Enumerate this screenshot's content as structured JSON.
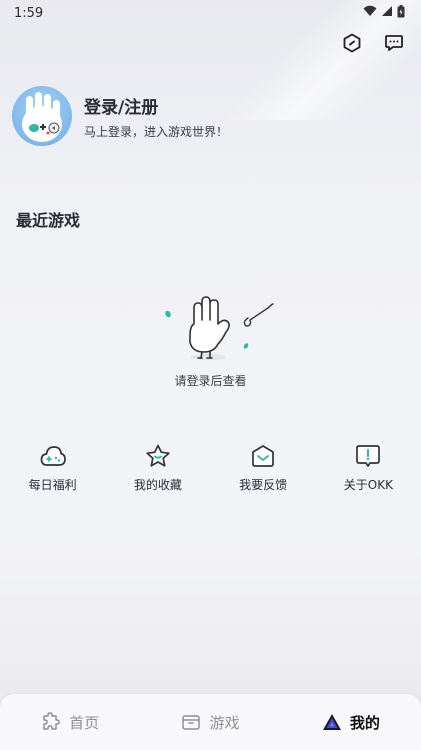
{
  "status_bar": {
    "time": "1:59",
    "icons": [
      "wifi-icon",
      "signal-icon",
      "battery-icon"
    ]
  },
  "top_actions": {
    "icons": [
      "settings-hex-icon",
      "message-icon"
    ]
  },
  "profile": {
    "title": "登录/注册",
    "subtitle": "马上登录，进入游戏世界！"
  },
  "recent_games": {
    "title": "最近游戏",
    "empty_text": "请登录后查看"
  },
  "quick_actions": [
    {
      "label": "每日福利",
      "icon": "cloud-gamepad-icon"
    },
    {
      "label": "我的收藏",
      "icon": "star-icon"
    },
    {
      "label": "我要反馈",
      "icon": "mail-icon"
    },
    {
      "label": "关于OKK",
      "icon": "info-message-icon"
    }
  ],
  "bottom_nav": [
    {
      "label": "首页",
      "icon": "puzzle-icon",
      "active": false
    },
    {
      "label": "游戏",
      "icon": "box-icon",
      "active": false
    },
    {
      "label": "我的",
      "icon": "triangle-logo-icon",
      "active": true
    }
  ],
  "colors": {
    "accent": "#2fb8a4",
    "text": "#2a2c33",
    "inactive": "#8e9097"
  }
}
